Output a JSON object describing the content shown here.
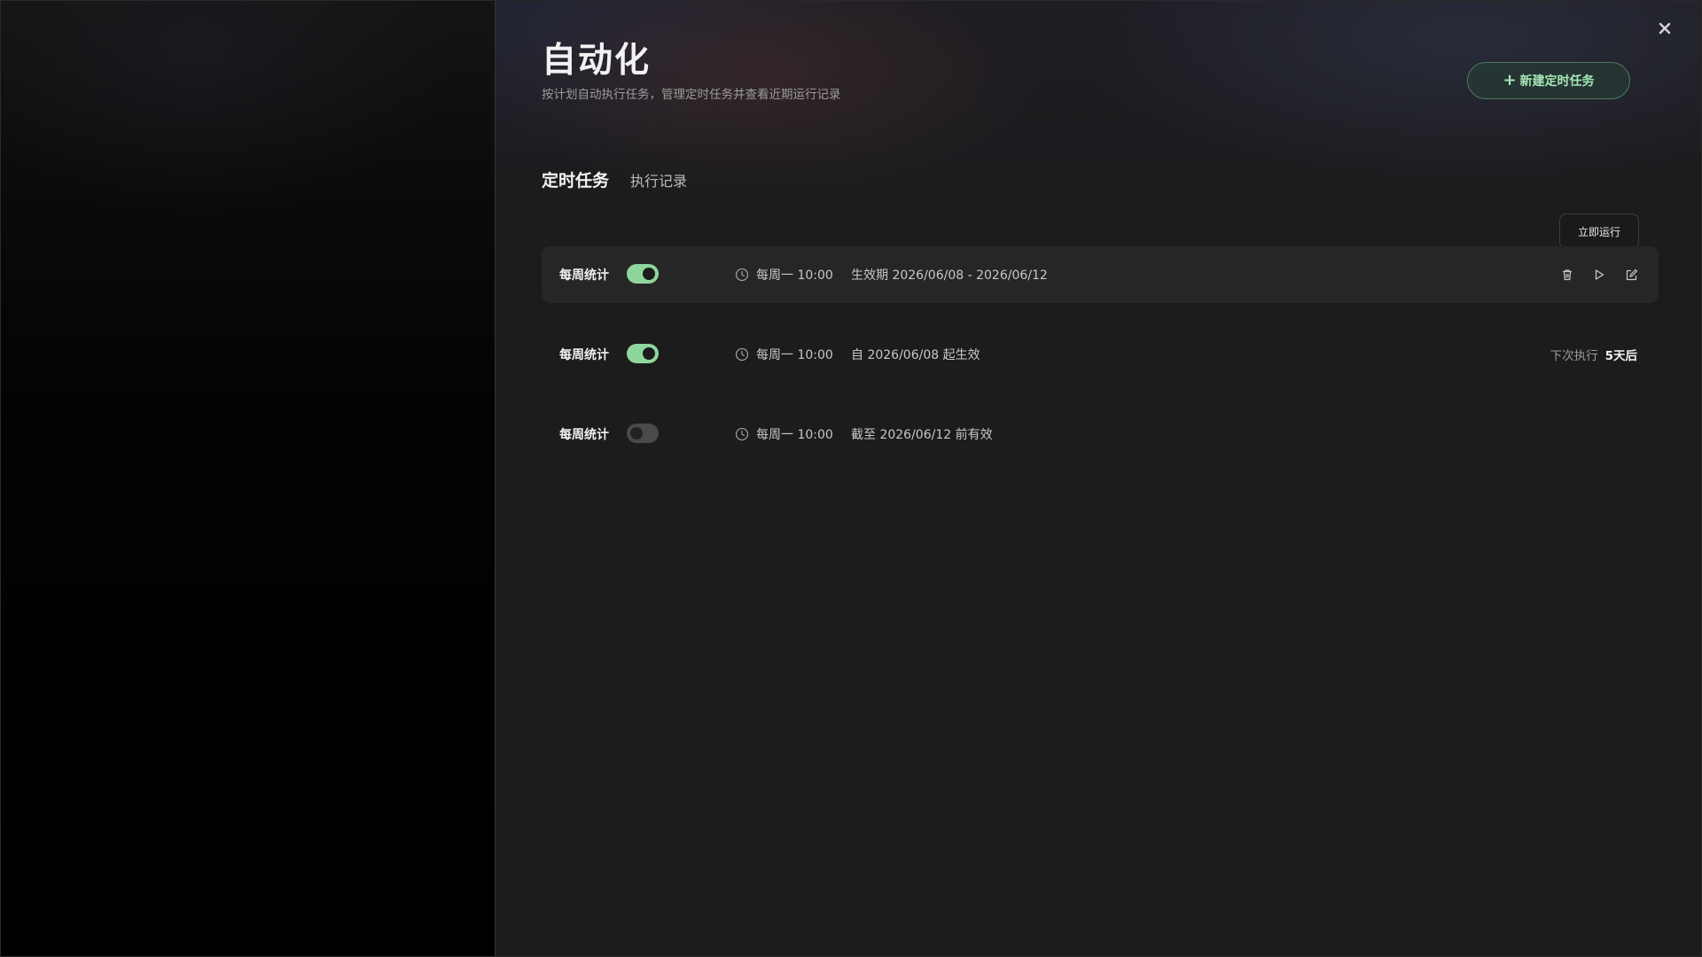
{
  "header": {
    "title": "自动化",
    "subtitle": "按计划自动执行任务，管理定时任务并查看近期运行记录",
    "new_task_label": "新建定时任务",
    "close_icon": "close-icon"
  },
  "tabs": [
    {
      "label": "定时任务",
      "active": true
    },
    {
      "label": "执行记录",
      "active": false
    }
  ],
  "tooltip": {
    "label": "立即运行"
  },
  "tasks": [
    {
      "name": "每周统计",
      "enabled": true,
      "schedule": "每周一 10:00",
      "validity": "生效期 2026/06/08 - 2026/06/12",
      "highlighted": true,
      "actions": [
        "trash-icon",
        "play-icon",
        "edit-icon"
      ]
    },
    {
      "name": "每周统计",
      "enabled": true,
      "schedule": "每周一 10:00",
      "validity": "自 2026/06/08 起生效",
      "next_run_label": "下次执行",
      "next_run_value": "5天后"
    },
    {
      "name": "每周统计",
      "enabled": false,
      "schedule": "每周一 10:00",
      "validity": "截至 2026/06/12 前有效"
    }
  ],
  "colors": {
    "accent": "#8ed69e",
    "accent_text": "#a6e8b8",
    "toggle_off": "#4a4a4a",
    "panel_bg": "#1c1c1c",
    "row_highlight": "#262626"
  }
}
